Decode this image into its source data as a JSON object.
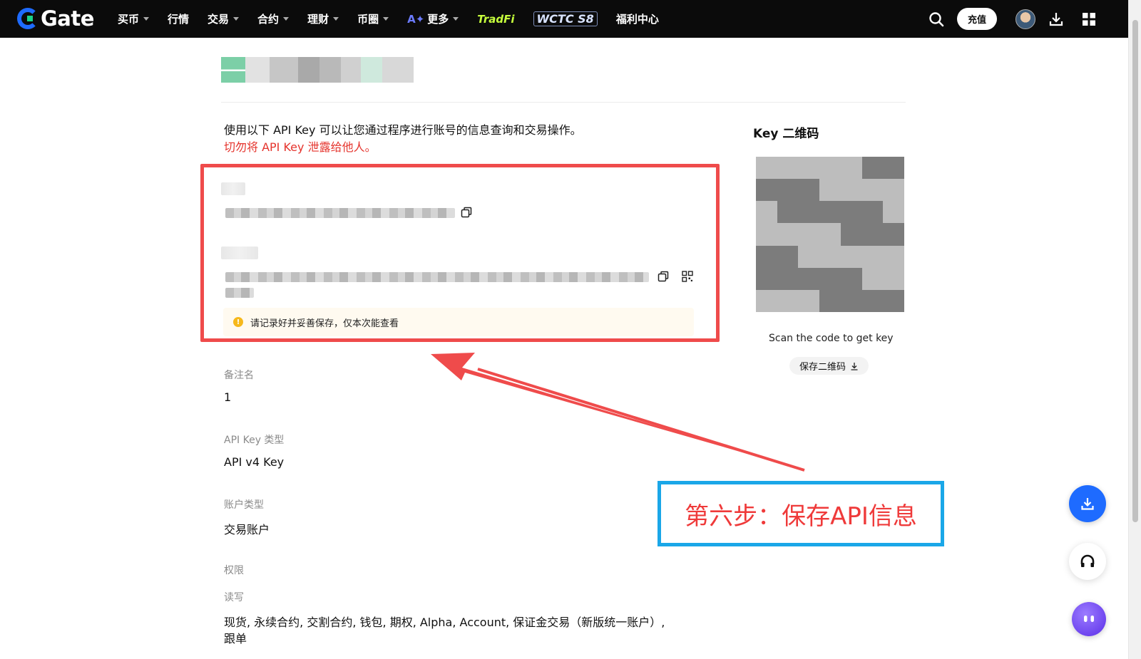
{
  "header": {
    "logo": "Gate",
    "nav": [
      "买币",
      "行情",
      "交易",
      "合约",
      "理财",
      "币圈",
      "更多",
      "TradFi",
      "WCTC S8",
      "福利中心"
    ],
    "nav_has_caret": [
      true,
      false,
      true,
      true,
      true,
      true,
      true,
      false,
      false,
      false
    ],
    "deposit_label": "充值"
  },
  "intro": {
    "line1": "使用以下 API Key 可以让您通过程序进行账号的信息查询和交易操作。",
    "line2": "切勿将 API Key 泄露给他人。"
  },
  "notice": "请记录好并妥善保存，仅本次能查看",
  "fields": [
    {
      "label": "备注名",
      "value": "1"
    },
    {
      "label": "API Key 类型",
      "value": "API v4 Key"
    },
    {
      "label": "账户类型",
      "value": "交易账户"
    }
  ],
  "permissions": {
    "label": "权限",
    "sub_label": "读写",
    "value_line1": "现货, 永续合约, 交割合约, 钱包, 期权, Alpha, Account, 保证金交易（新版统一账户）,",
    "value_line2": "跟单"
  },
  "qr": {
    "title": "Key 二维码",
    "caption": "Scan the code to get key",
    "save_label": "保存二维码"
  },
  "annotation": "第六步：保存API信息",
  "colors": {
    "accent_red": "#ef4b4b",
    "annotation_blue": "#1aa7e8",
    "brand_blue": "#1e6bff",
    "brand_green": "#19d38a"
  }
}
